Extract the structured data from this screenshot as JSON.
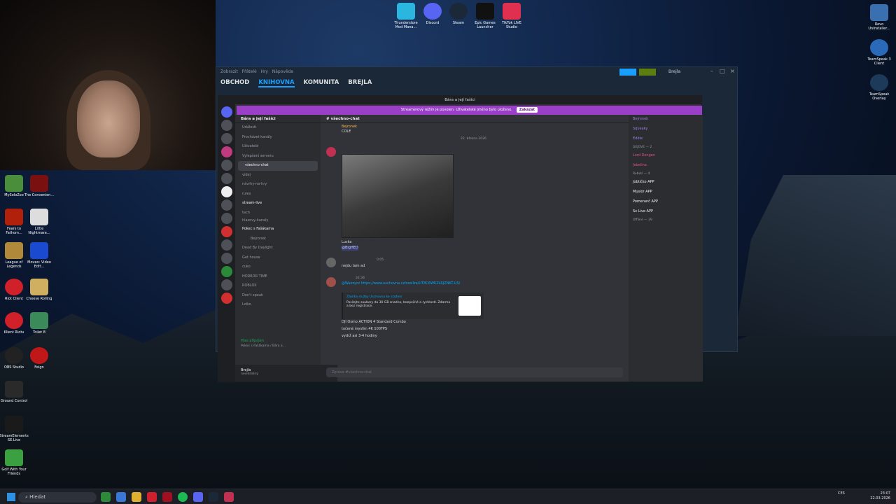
{
  "desktop": {
    "top_icons": [
      "Thunderstore Mod Mana...",
      "Discord",
      "Steam",
      "Epic Games Launcher",
      "TikTok LIVE Studio"
    ],
    "right_icons": [
      "Revo Uninstaller...",
      "TeamSpeak 3 Client",
      "TeamSpeak Overlay"
    ],
    "left_icons": [
      "MySoloZoo",
      "The Convenien...",
      "Fears to Fathom...",
      "Little Nightmare...",
      "League of Legends",
      "Moveo: Video Edit...",
      "Riot Client",
      "Cheese Rolling",
      "Klient Riotu",
      "Toilet 8",
      "OBS Studio",
      "Feign",
      "Ground Control",
      "StreamElements SE.Live",
      "Golf With Your Friends"
    ]
  },
  "steam": {
    "menu": [
      "Zobrazit",
      "Přátelé",
      "Hry",
      "Nápověda"
    ],
    "nav": [
      "OBCHOD",
      "KNIHOVNA",
      "KOMUNITA",
      "BREJLA"
    ],
    "user": "Brejla"
  },
  "discord": {
    "window_title": "Bára a její fašíci",
    "banner_text": "Streamerový režim je povolen. Uživatelské jméno bylo uloženo.",
    "banner_button": "Zakázat",
    "server_name": "Bára a její fašíci",
    "channel_title": "všechno-chat",
    "search_placeholder": "Vyhledat Bára a její fašíci",
    "menu_items": [
      "Události",
      "Procházet kanály",
      "Uživatelé",
      "Vylepšení serveru"
    ],
    "channels": [
      "všechno-chat",
      "videj",
      "návrhy-na-hry",
      "rules",
      "stream-live",
      "tech",
      "hlasovy-kanaly",
      "Pokec s Fašákama",
      "Bejronek",
      "Dead By Daylight",
      "Get house",
      "cuko",
      "HORROR TIME",
      "ROBLOX",
      "Don't speak",
      "Lolko"
    ],
    "voice_status": "Hlas připojen",
    "voice_sub": "Pokec s Fašákama / Bára a...",
    "user_name": "Brejla",
    "user_status": "neviditelný",
    "messages": {
      "m1_author": "Bejronek",
      "m1_text": "COLE",
      "date_divider": "22. března 2026",
      "m2_caption": "Lucka",
      "m2_mention": "@BigHED",
      "m3_time": "0:05",
      "m3_text": "nejdu tam ad",
      "m4_time": "22:34",
      "m4_link": "@Wazzycz https://www.uschovna.cz/zasilka/UT8C6WKZLRJZNKT-US/",
      "embed_title": "Zásilka služby Úschovna ke stažení",
      "embed_desc": "Posílejte soubory do 30 GB snadno, bezpečně a rychlostí. Zdarma a bez registrace.",
      "m5_lines": [
        "DJI Osmo ACTION 4 Standard Combo",
        "točené myslim 4K 100FPS",
        "vydrž asi 3-4 hodiny"
      ],
      "input_placeholder": "Zpráva #všechno-chat"
    },
    "members": {
      "top": [
        "Bejronek",
        "Squeaky",
        "Eddie"
      ],
      "group1_header": "GEJOVE — 2",
      "group1": [
        "Lord Dengen",
        "Jebelina"
      ],
      "group2_header": "Roboti — 4",
      "group2": [
        "Jobtičko APP",
        "Muslor APP",
        "Pomeranč APP",
        "Sx Live APP"
      ],
      "group3_header": "Offline — 39"
    }
  },
  "taskbar": {
    "search_placeholder": "Hledat",
    "lang": "CES",
    "time": "23:07",
    "date": "22.03.2026"
  },
  "colors": {
    "discord_accent": "#9b3ec8",
    "steam_accent": "#1a9fff"
  }
}
